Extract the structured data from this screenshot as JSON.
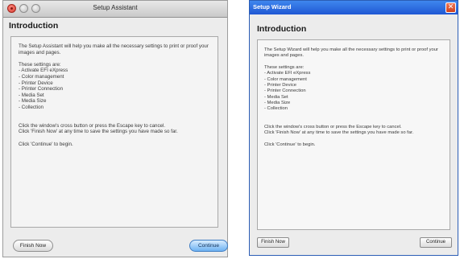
{
  "mac_window": {
    "title": "Setup Assistant",
    "heading": "Introduction",
    "intro": "The Setup Assistant will help you make all the necessary settings to print or proof your images and pages.",
    "settings_heading": "These settings are:",
    "settings": [
      "- Activate EFI eXpress",
      "- Color management",
      "- Printer Device",
      "- Printer Connection",
      "- Media Set",
      "- Media Size",
      "- Collection"
    ],
    "cancel_text": "Click the window's cross button or press the Escape key to cancel.",
    "finish_text": "Click 'Finish Now' at any time to save the settings you have made so far.",
    "begin_text": "Click 'Continue' to begin.",
    "finish_button": "Finish Now",
    "continue_button": "Continue"
  },
  "win_window": {
    "title": "Setup Wizard",
    "heading": "Introduction",
    "intro": "The Setup Wizard will help you make all the necessary settings to print or proof your images and pages.",
    "settings_heading": "These settings are:",
    "settings": [
      "- Activate EFI eXpress",
      "- Color management",
      "- Printer Device",
      "- Printer Connection",
      "- Media Set",
      "- Media Size",
      "- Collection"
    ],
    "cancel_text": "Click the window's cross button or press the Escape key to cancel.",
    "finish_text": "Click 'Finish Now' at any time to save the settings you have made so far.",
    "begin_text": "Click 'Continue' to begin.",
    "finish_button": "Finish Now",
    "continue_button": "Continue",
    "close_glyph": "✕"
  },
  "colors": {
    "mac_close": "#d43a2f",
    "win_titlebar": "#1f57d3",
    "mac_continue": "#6eb2f2"
  }
}
